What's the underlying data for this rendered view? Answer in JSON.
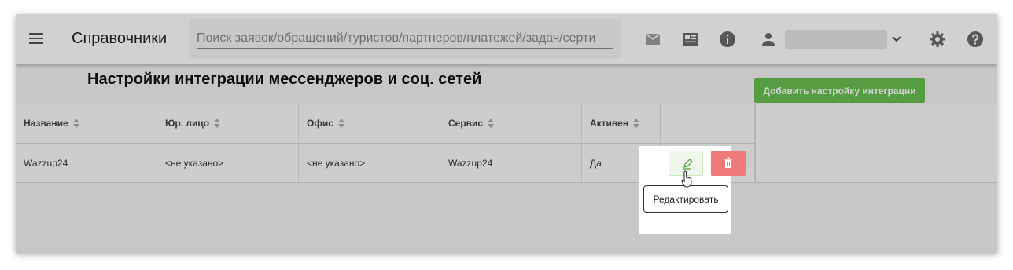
{
  "header": {
    "menu_icon": "hamburger-menu-icon",
    "title": "Справочники",
    "search_placeholder": "Поиск заявок/обращений/туристов/партнеров/платежей/задач/серти",
    "icons": [
      "mail-icon",
      "news-icon",
      "info-icon",
      "user-icon",
      "chevron-down-icon",
      "gear-icon",
      "help-icon"
    ],
    "user_name": ""
  },
  "page": {
    "title": "Настройки интеграции мессенджеров и соц. сетей",
    "add_button": "Добавить настройку интеграции",
    "accent_color": "#69c050",
    "delete_color": "#f07a7a"
  },
  "table": {
    "columns": [
      "Название",
      "Юр. лицо",
      "Офис",
      "Сервис",
      "Активен"
    ],
    "rows": [
      {
        "name": "Wazzup24",
        "legal_entity": "<не указано>",
        "office": "<не указано>",
        "service": "Wazzup24",
        "active": "Да"
      }
    ]
  },
  "tooltip": "Редактировать"
}
